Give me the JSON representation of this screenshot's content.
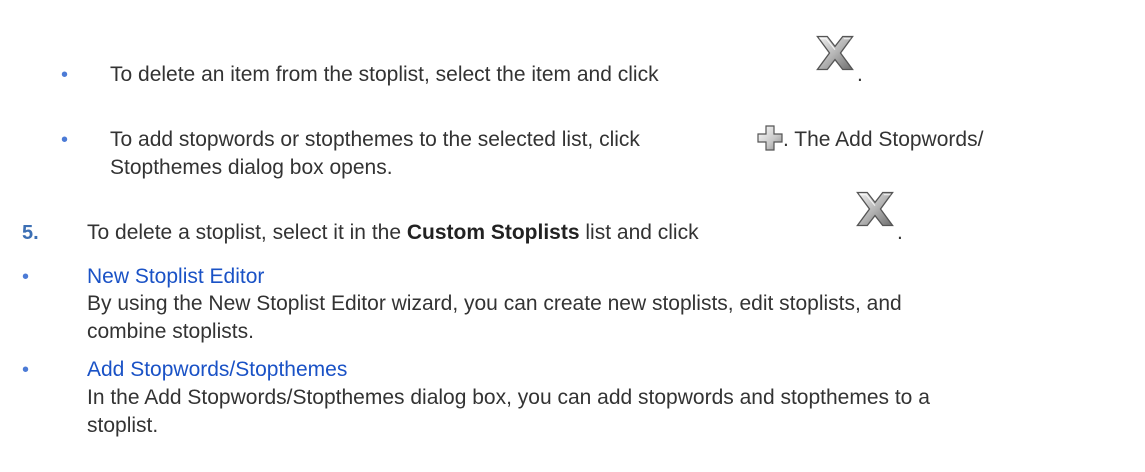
{
  "sub_bullets": [
    {
      "text_before_icon": "To delete an item from the stoplist, select the item and click",
      "icon": "delete-x-icon",
      "text_after_icon": "."
    },
    {
      "text_before_icon": "To add stopwords or stopthemes to the selected list, click",
      "icon": "add-plus-icon",
      "text_after_icon": ". The Add Stopwords/",
      "continuation": "Stopthemes dialog box opens."
    }
  ],
  "step5": {
    "number": "5.",
    "text_before_bold": "To delete a stoplist, select it in the",
    "bold": "Custom Stoplists",
    "text_after_bold": "list and click",
    "icon": "delete-x-icon",
    "text_after_icon": "."
  },
  "related_links": [
    {
      "title": "New Stoplist Editor",
      "description_line1": "By using the New Stoplist Editor wizard, you can create new stoplists, edit stoplists, and",
      "description_line2": "combine stoplists."
    },
    {
      "title": "Add Stopwords/Stopthemes",
      "description_line1": "In the Add Stopwords/Stopthemes dialog box, you can add stopwords and stopthemes to a",
      "description_line2": "stoplist."
    }
  ],
  "colors": {
    "text": "#333333",
    "link": "#1a52c6",
    "bullet": "#4c7bd6"
  }
}
